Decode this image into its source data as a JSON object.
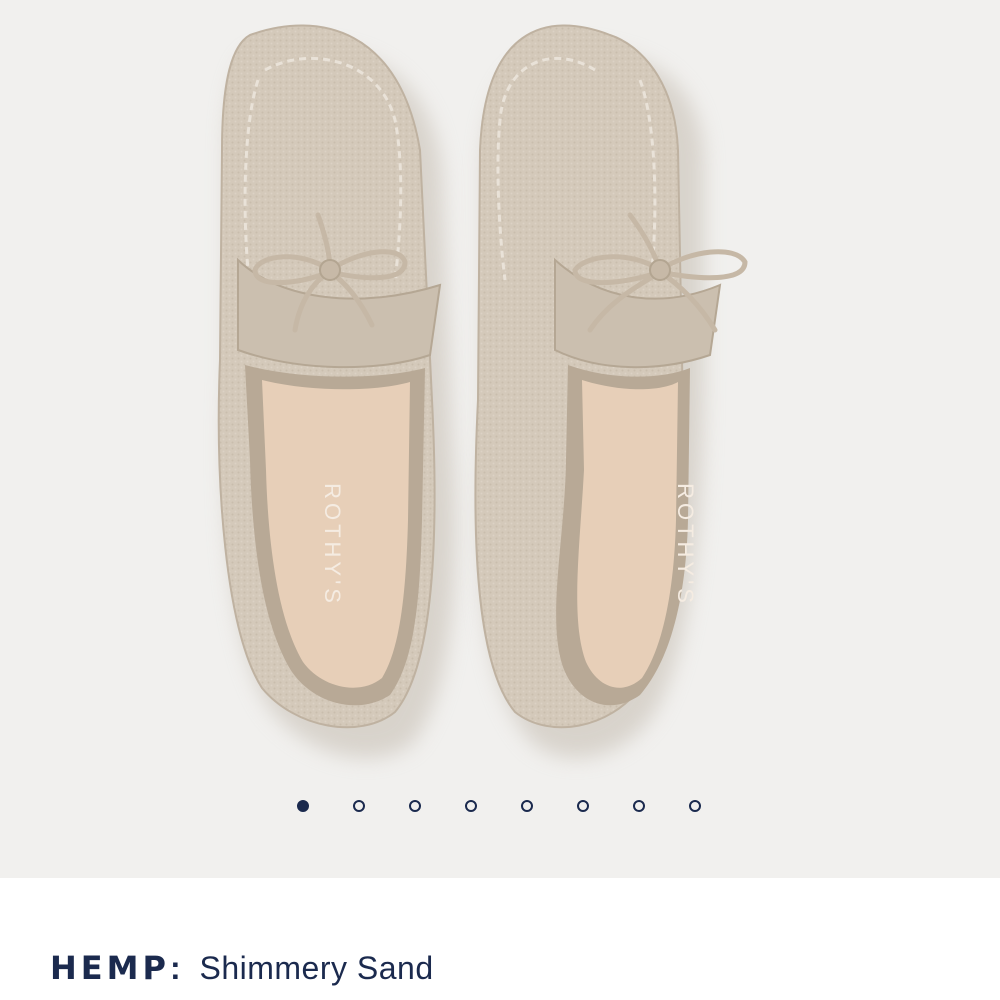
{
  "gallery": {
    "image_alt": "Pair of sand-colored knit loafers with bow laces",
    "insole_brand": "ROTHY'S",
    "dot_count": 8,
    "active_index": 0,
    "colors": {
      "shoe": "#d3c7b8",
      "shoe_shadow": "#b9ab99",
      "insole": "#e6cdb6",
      "background": "#f1f0ee",
      "dot": "#1b2a4e"
    }
  },
  "product": {
    "material": "HEMP",
    "separator": ":",
    "color_name": "Shimmery Sand"
  }
}
